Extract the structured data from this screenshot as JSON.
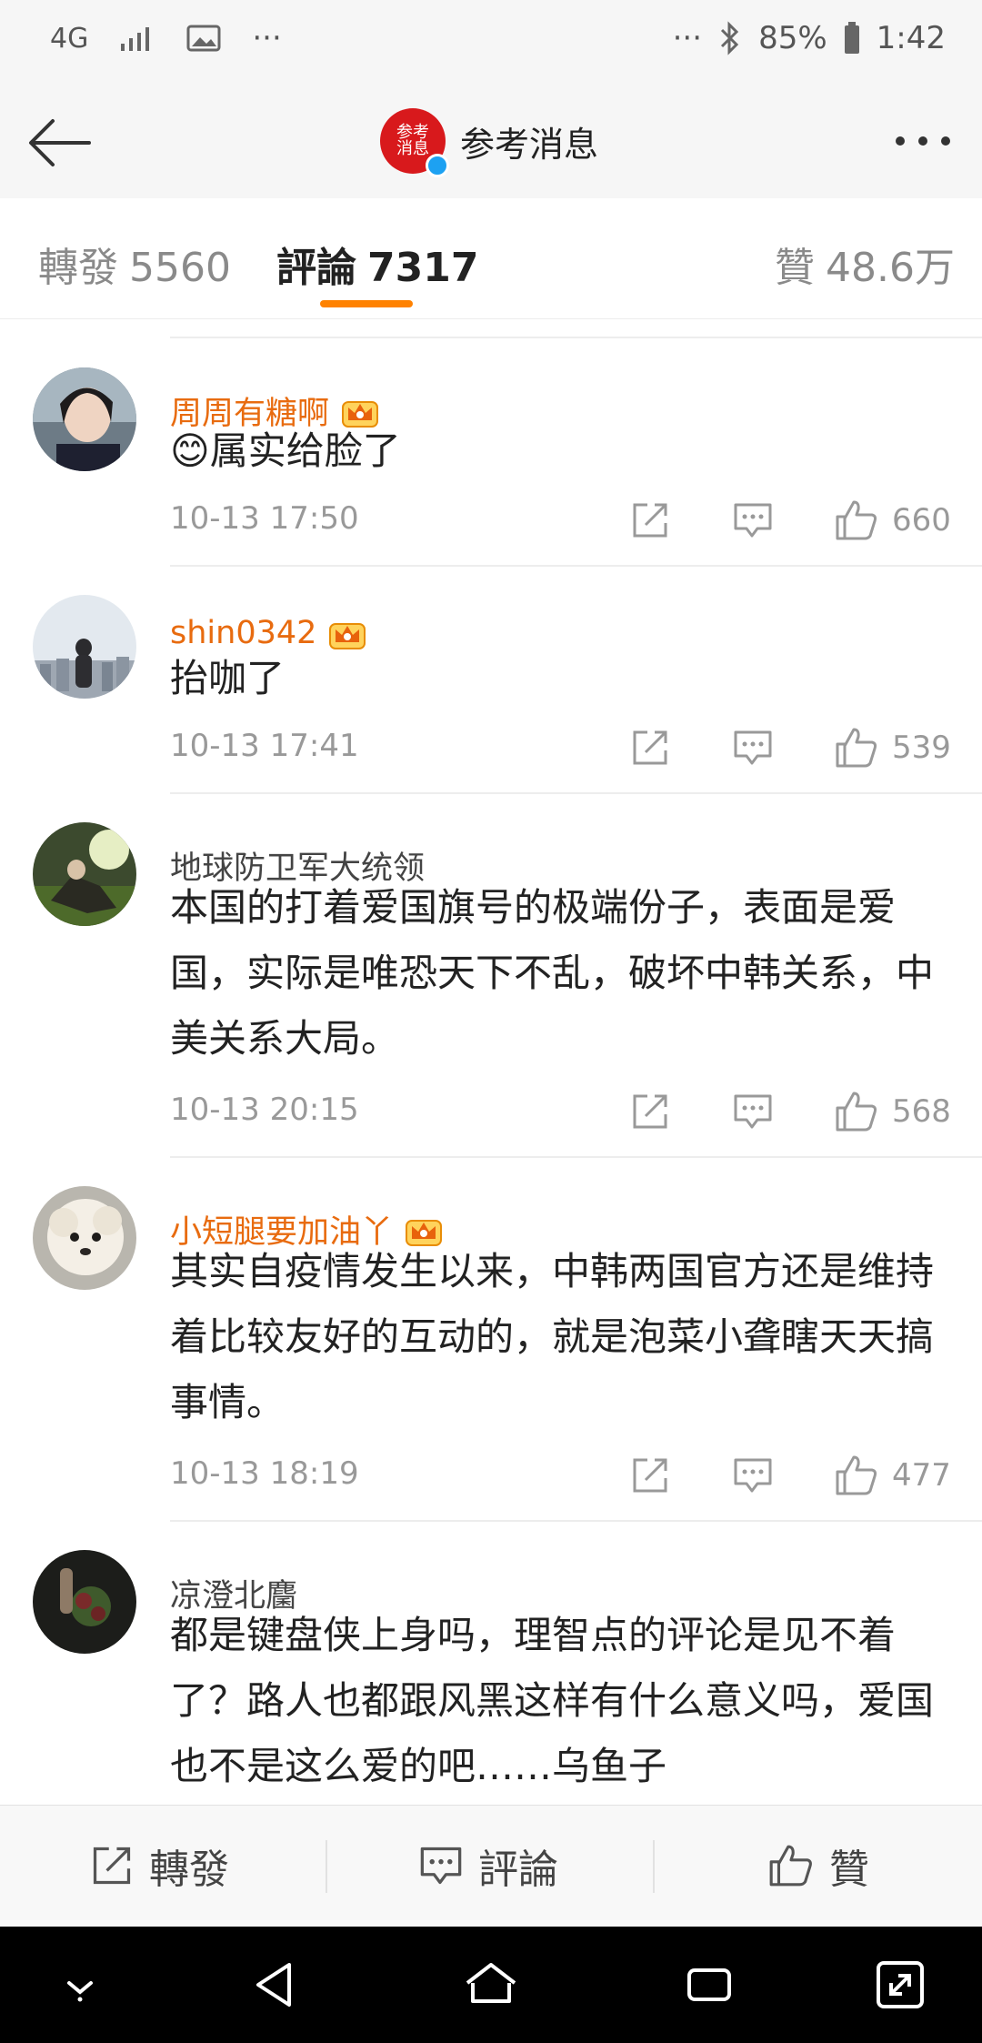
{
  "status_bar": {
    "network": "4G",
    "more_left": "···",
    "more_right": "···",
    "battery": "85%",
    "time": "1:42"
  },
  "header": {
    "title": "参考消息",
    "logo_text": "参考消息"
  },
  "tabs": [
    {
      "label": "轉發",
      "count": "5560"
    },
    {
      "label": "評論",
      "count": "7317"
    },
    {
      "label": "贊",
      "count": "48.6万"
    }
  ],
  "comments": [
    {
      "name": "周周有糖啊",
      "vip": true,
      "text": "😊属实给脸了",
      "time": "10-13 17:50",
      "likes": "660"
    },
    {
      "name": "shin0342",
      "vip": true,
      "text": "抬咖了",
      "time": "10-13 17:41",
      "likes": "539"
    },
    {
      "name": "地球防卫军大统领",
      "vip": false,
      "text": "本国的打着爱国旗号的极端份子，表面是爱国，实际是唯恐天下不乱，破坏中韩关系，中美关系大局。",
      "time": "10-13 20:15",
      "likes": "568"
    },
    {
      "name": "小短腿要加油丫",
      "vip": true,
      "text": "其实自疫情发生以来，中韩两国官方还是维持着比较友好的互动的，就是泡菜小聋瞎天天搞事情。",
      "time": "10-13 18:19",
      "likes": "477"
    },
    {
      "name": "凉澄北麕",
      "vip": false,
      "text": "都是键盘侠上身吗，理智点的评论是见不着了？路人也都跟风黑这样有什么意义吗，爱国也不是这么爱的吧……乌鱼子",
      "time": "",
      "likes": ""
    }
  ],
  "bottom_bar": {
    "repost": "轉發",
    "comment": "評論",
    "like": "贊"
  },
  "colors": {
    "accent": "#ff8200",
    "vip_name": "#e86b0f",
    "logo_red": "#d8191c"
  }
}
